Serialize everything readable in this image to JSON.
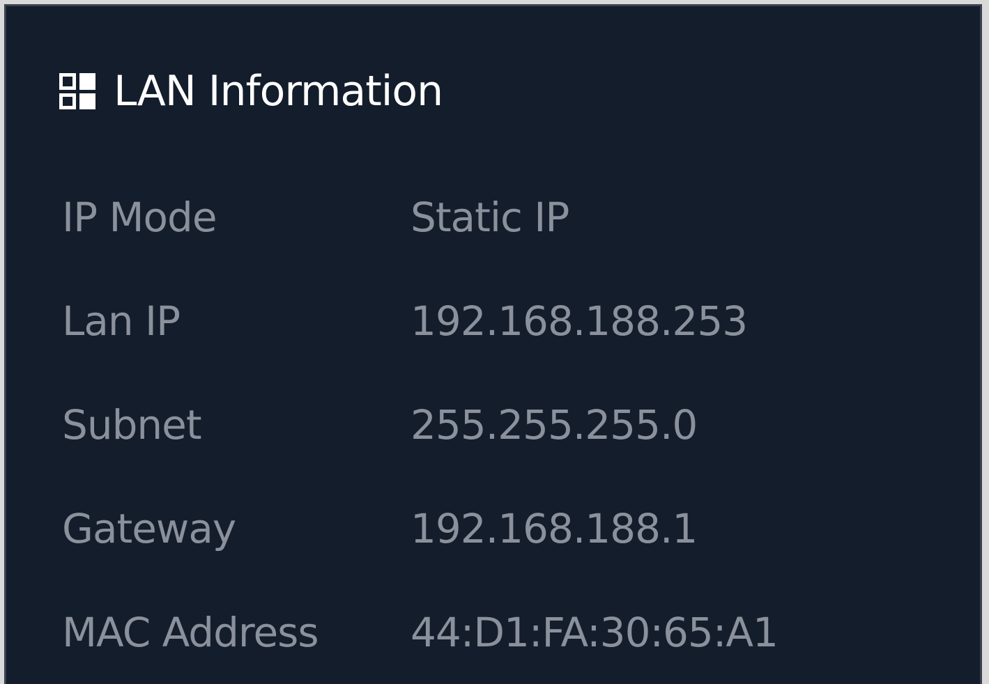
{
  "panel": {
    "title": "LAN Information",
    "icon": "grid-icon"
  },
  "rows": [
    {
      "label": "IP Mode",
      "value": "Static IP"
    },
    {
      "label": "Lan IP",
      "value": "192.168.188.253"
    },
    {
      "label": "Subnet",
      "value": "255.255.255.0"
    },
    {
      "label": "Gateway",
      "value": "192.168.188.1"
    },
    {
      "label": "MAC Address",
      "value": "44:D1:FA:30:65:A1"
    }
  ],
  "colors": {
    "background": "#141d2b",
    "title": "#ffffff",
    "text": "#8a919c"
  }
}
